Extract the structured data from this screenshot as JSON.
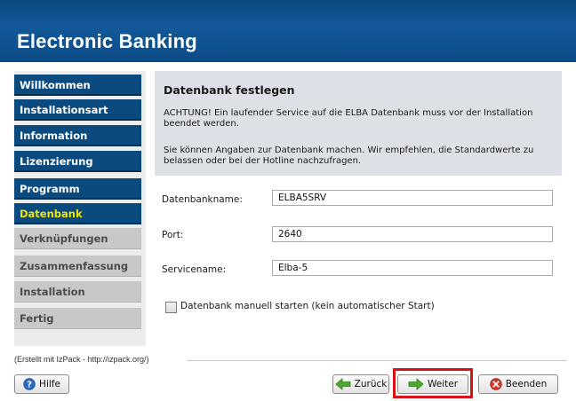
{
  "header": {
    "title": "Electronic Banking"
  },
  "sidebar": {
    "items": [
      {
        "label": "Willkommen",
        "state": "done"
      },
      {
        "label": "Installationsart",
        "state": "done"
      },
      {
        "label": "Information",
        "state": "done"
      },
      {
        "label": "Lizenzierung",
        "state": "done"
      },
      {
        "label": "Programm",
        "state": "done"
      },
      {
        "label": "Datenbank",
        "state": "current"
      },
      {
        "label": "Verknüpfungen",
        "state": "todo"
      },
      {
        "label": "Zusammenfassung",
        "state": "todo"
      },
      {
        "label": "Installation",
        "state": "todo"
      },
      {
        "label": "Fertig",
        "state": "todo"
      }
    ]
  },
  "panel": {
    "title": "Datenbank festlegen",
    "warning": "ACHTUNG! Ein laufender Service auf die ELBA Datenbank muss vor der Installation beendet werden.",
    "hint": "Sie können Angaben zur Datenbank machen. Wir empfehlen, die Standardwerte zu belassen oder bei der Hotline nachzufragen."
  },
  "form": {
    "dbname_label": "Datenbankname:",
    "dbname_value": "ELBA5SRV",
    "port_label": "Port:",
    "port_value": "2640",
    "service_label": "Servicename:",
    "service_value": "Elba-5",
    "manual_start_label": "Datenbank manuell starten (kein automatischer Start)",
    "manual_start_checked": false
  },
  "footer": {
    "credit": "(Erstellt mit IzPack - http://izpack.org/)",
    "help_label": "Hilfe",
    "back_label": "Zurück",
    "next_label": "Weiter",
    "quit_label": "Beenden"
  },
  "colors": {
    "nav_done": "#0b4a7e",
    "nav_current_text": "#f2e600",
    "nav_todo": "#c8c8c8",
    "highlight": "#d9121a"
  }
}
